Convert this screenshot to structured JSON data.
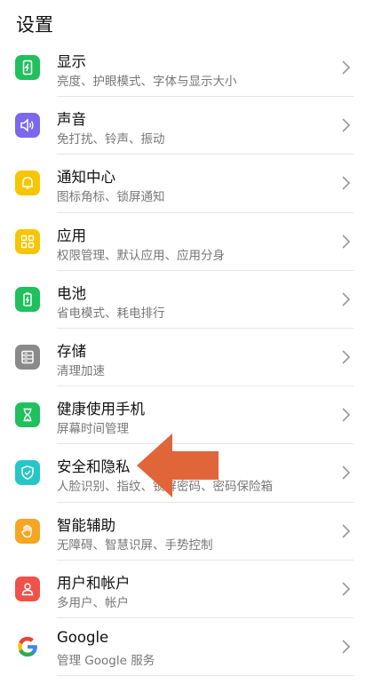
{
  "header": {
    "title": "设置"
  },
  "items": [
    {
      "label": "显示",
      "sub": "亮度、护眼模式、字体与显示大小",
      "icon": "phone-brightness-icon",
      "color": "#20c05c"
    },
    {
      "label": "声音",
      "sub": "免打扰、铃声、振动",
      "icon": "speaker-icon",
      "color": "#7b68ee"
    },
    {
      "label": "通知中心",
      "sub": "图标角标、锁屏通知",
      "icon": "bell-icon",
      "color": "#f7c600"
    },
    {
      "label": "应用",
      "sub": "权限管理、默认应用、应用分身",
      "icon": "apps-grid-icon",
      "color": "#f7c600"
    },
    {
      "label": "电池",
      "sub": "省电模式、耗电排行",
      "icon": "battery-icon",
      "color": "#20c05c"
    },
    {
      "label": "存储",
      "sub": "清理加速",
      "icon": "storage-icon",
      "color": "#8a8a8a"
    },
    {
      "label": "健康使用手机",
      "sub": "屏幕时间管理",
      "icon": "hourglass-icon",
      "color": "#20c05c"
    },
    {
      "label": "安全和隐私",
      "sub": "人脸识别、指纹、锁屏密码、密码保险箱",
      "icon": "shield-check-icon",
      "color": "#26c6c6"
    },
    {
      "label": "智能辅助",
      "sub": "无障碍、智慧识屏、手势控制",
      "icon": "hand-icon",
      "color": "#f5a623"
    },
    {
      "label": "用户和帐户",
      "sub": "多用户、帐户",
      "icon": "user-icon",
      "color": "#f0524a"
    },
    {
      "label": "Google",
      "sub": "管理 Google 服务",
      "icon": "google-icon",
      "color": "#ffffff"
    }
  ],
  "annotation": {
    "icon": "left-arrow-annotation",
    "color": "#e0663a"
  }
}
